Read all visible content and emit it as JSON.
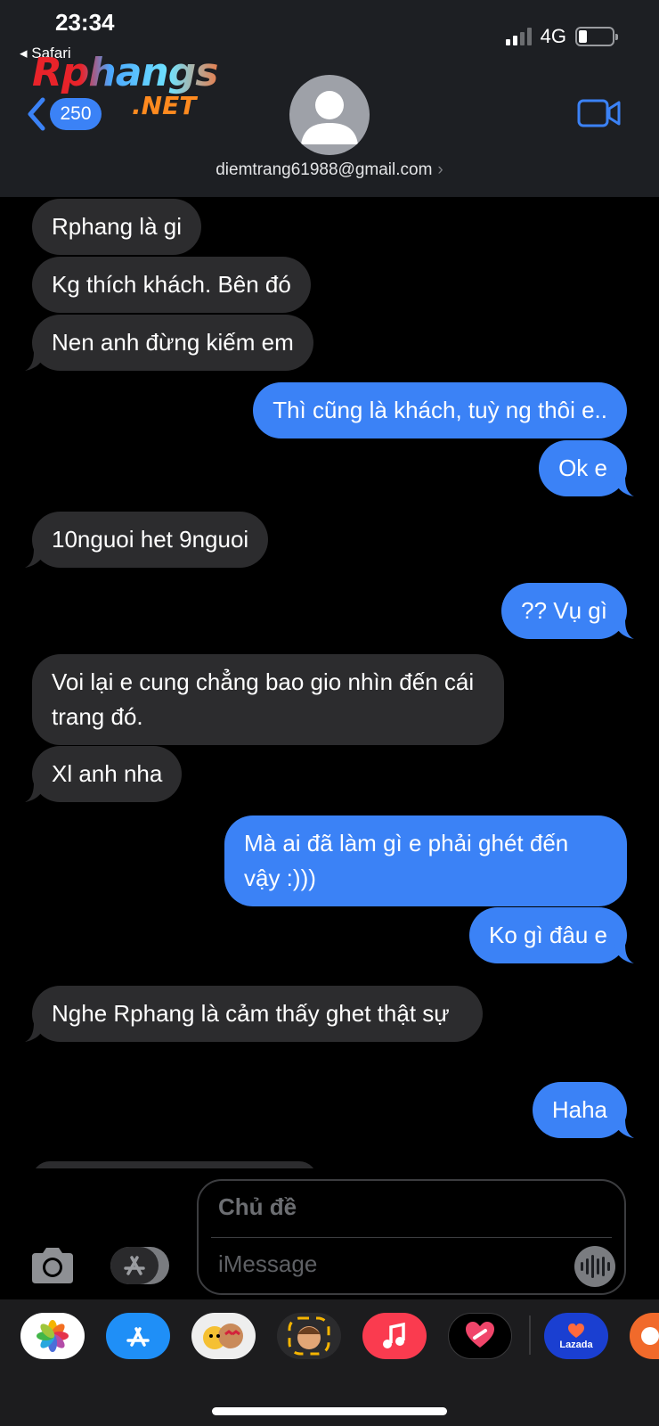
{
  "status_bar": {
    "time": "23:34",
    "back_app": "◂ Safari",
    "network": "4G"
  },
  "watermark": {
    "main": "Rphangs",
    "sub": ".NET"
  },
  "header": {
    "unread_count": "250",
    "contact": "diemtrang61988@gmail.com",
    "contact_chevron": "›"
  },
  "messages": [
    {
      "side": "in",
      "text": "Rphang là gi"
    },
    {
      "side": "in",
      "text": "Kg thích khách. Bên đó"
    },
    {
      "side": "in",
      "text": "Nen anh đừng kiếm em"
    },
    {
      "side": "out",
      "text": "Thì cũng là khách, tuỳ ng thôi e.."
    },
    {
      "side": "out",
      "text": "Ok e"
    },
    {
      "side": "in",
      "text": "10nguoi het 9nguoi"
    },
    {
      "side": "out",
      "text": "?? Vụ gì"
    },
    {
      "side": "in",
      "text": "Voi lại e cung chẳng bao gio nhìn đến cái trang đó."
    },
    {
      "side": "in",
      "text": "Xl anh nha"
    },
    {
      "side": "out",
      "text": "Mà ai đã làm gì e phải ghét đến vậy :)))"
    },
    {
      "side": "out",
      "text": "Ko gì đâu e"
    },
    {
      "side": "in",
      "text": "Nghe Rphang là cảm thấy ghet thật sự"
    },
    {
      "side": "out",
      "text": "Haha"
    }
  ],
  "composer": {
    "subject_placeholder": "Chủ đề",
    "message_placeholder": "iMessage"
  },
  "app_drawer": {
    "apps": [
      "photos-icon",
      "app-store-icon",
      "memoji-stickers-icon",
      "memoji-icon",
      "music-icon",
      "heart-digital-touch-icon",
      "lazada-icon",
      "partial-app-icon"
    ],
    "lazada_label": "Lazada"
  },
  "colors": {
    "outgoing_bubble": "#3b82f6",
    "incoming_bubble": "#2c2c2e",
    "header_bg": "#1d1f23",
    "accent": "#3b82f6"
  }
}
